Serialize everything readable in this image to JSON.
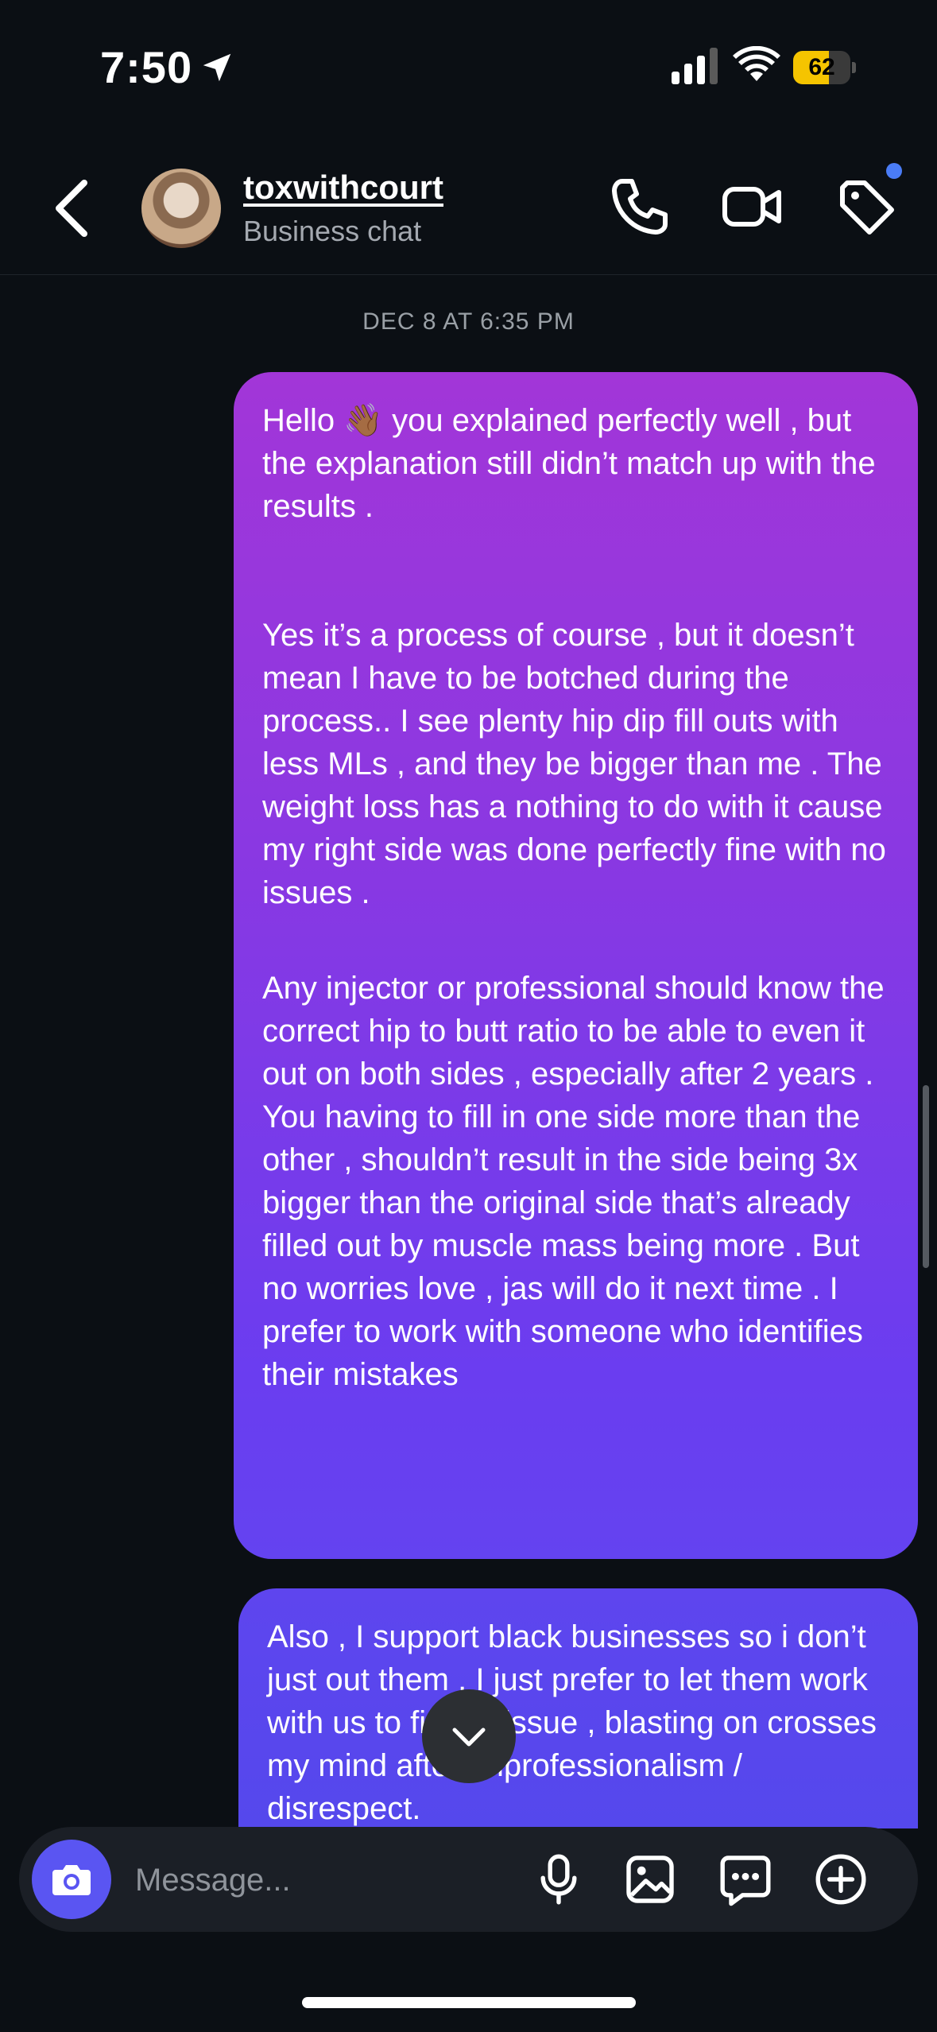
{
  "status_bar": {
    "time": "7:50",
    "battery": 62,
    "battery_label": "62"
  },
  "header": {
    "username": "toxwithcourt",
    "subtitle": "Business chat",
    "icons": [
      "back-arrow-icon",
      "phone-icon",
      "video-icon",
      "tag-icon"
    ]
  },
  "thread": {
    "timestamp": "DEC 8 AT 6:35 PM",
    "messages": [
      {
        "paragraphs": [
          "Hello 👋🏾 you explained perfectly well , but the explanation still didn’t match up with the results .",
          "Yes it’s a process of course , but it doesn’t mean I have to be botched during the process.. I see plenty hip dip fill outs with less MLs , and they be bigger than me . The weight loss has a nothing to do with it cause my right side was done perfectly fine with no issues .",
          "Any injector or professional should know the correct hip to butt ratio to be able to even it out on both sides , especially after 2 years . You having to fill in one side more than the other , shouldn’t result in the side being 3x bigger than the original side that’s already filled out by muscle mass being more . But no worries love , jas will do it next time . I prefer to work with someone who identifies their mistakes"
        ]
      },
      {
        "paragraphs": [
          "Also , I support black businesses so i don’t just out them . I just prefer to let them work with us to fix the issue , blasting on crosses my mind after unprofessionalism / disrespect."
        ]
      }
    ]
  },
  "composer": {
    "placeholder": "Message...",
    "icons": [
      "camera-icon",
      "microphone-icon",
      "gallery-icon",
      "sticker-icon",
      "plus-icon"
    ]
  },
  "colors": {
    "background": "#0b0f14",
    "bubble_top": "#a236d8",
    "bubble_bottom": "#5149ec",
    "camera_button": "#5a55f2"
  }
}
